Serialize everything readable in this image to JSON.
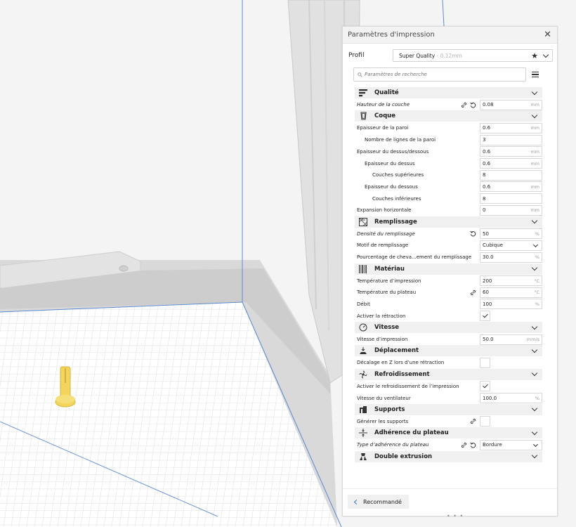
{
  "panel": {
    "title": "Paramètres d'impression",
    "profile_label": "Profil",
    "profile_name": "Super Quality",
    "profile_sub": " - 0.12mm",
    "search_placeholder": "Paramètres de recherche",
    "recommend_label": "Recommandé",
    "handle": "• • •"
  },
  "colors": {
    "accent": "#3e6fb3",
    "model": "#f2d55d",
    "buildplate": "#ffffff",
    "grid": "#d7d7d7",
    "frame": "#dcdcdc"
  },
  "categories": [
    {
      "label": "Qualité",
      "icon": "quality-icon",
      "settings": [
        {
          "label": "Hauteur de la couche",
          "italic": true,
          "indent": 0,
          "type": "number",
          "value": "0.08",
          "unit": "mm",
          "icons": [
            "link",
            "reset"
          ]
        }
      ]
    },
    {
      "label": "Coque",
      "icon": "shell-icon",
      "settings": [
        {
          "label": "Épaisseur de la paroi",
          "indent": 0,
          "type": "number",
          "value": "0.6",
          "unit": "mm"
        },
        {
          "label": "Nombre de lignes de la paroi",
          "indent": 1,
          "type": "number",
          "value": "3",
          "unit": ""
        },
        {
          "label": "Épaisseur du dessus/dessous",
          "indent": 0,
          "type": "number",
          "value": "0.6",
          "unit": "mm"
        },
        {
          "label": "Épaisseur du dessus",
          "indent": 1,
          "type": "number",
          "value": "0.6",
          "unit": "mm"
        },
        {
          "label": "Couches supérieures",
          "indent": 2,
          "type": "number",
          "value": "8",
          "unit": ""
        },
        {
          "label": "Épaisseur du dessous",
          "indent": 1,
          "type": "number",
          "value": "0.6",
          "unit": "mm"
        },
        {
          "label": "Couches inférieures",
          "indent": 2,
          "type": "number",
          "value": "8",
          "unit": ""
        },
        {
          "label": "Expansion horizontale",
          "indent": 0,
          "type": "number",
          "value": "0",
          "unit": "mm"
        }
      ]
    },
    {
      "label": "Remplissage",
      "icon": "infill-icon",
      "settings": [
        {
          "label": "Densité du remplissage",
          "italic": true,
          "indent": 0,
          "type": "number",
          "value": "50",
          "unit": "%",
          "icons": [
            "reset"
          ]
        },
        {
          "label": "Motif de remplissage",
          "indent": 0,
          "type": "select",
          "value": "Cubique"
        },
        {
          "label": "Pourcentage de cheva...ement du remplissage",
          "indent": 0,
          "type": "number",
          "value": "30.0",
          "unit": "%"
        }
      ]
    },
    {
      "label": "Matériau",
      "icon": "material-icon",
      "settings": [
        {
          "label": "Température d’impression",
          "indent": 0,
          "type": "number",
          "value": "200",
          "unit": "°C"
        },
        {
          "label": "Température du plateau",
          "indent": 0,
          "type": "number",
          "value": "60",
          "unit": "°C",
          "icons": [
            "link"
          ]
        },
        {
          "label": "Débit",
          "indent": 0,
          "type": "number",
          "value": "100",
          "unit": "%"
        },
        {
          "label": "Activer la rétraction",
          "indent": 0,
          "type": "checkbox",
          "checked": true
        }
      ]
    },
    {
      "label": "Vitesse",
      "icon": "speed-icon",
      "settings": [
        {
          "label": "Vitesse d’impression",
          "indent": 0,
          "type": "number",
          "value": "50.0",
          "unit": "mm/s"
        }
      ]
    },
    {
      "label": "Déplacement",
      "icon": "travel-icon",
      "settings": [
        {
          "label": "Décalage en Z lors d’une rétraction",
          "indent": 0,
          "type": "checkbox",
          "checked": false
        }
      ]
    },
    {
      "label": "Refroidissement",
      "icon": "cooling-icon",
      "settings": [
        {
          "label": "Activer le refroidissement de l’impression",
          "indent": 0,
          "type": "checkbox",
          "checked": true
        },
        {
          "label": "Vitesse du ventilateur",
          "indent": 0,
          "type": "number",
          "value": "100.0",
          "unit": "%"
        }
      ]
    },
    {
      "label": "Supports",
      "icon": "support-icon",
      "settings": [
        {
          "label": "Générer les supports",
          "indent": 0,
          "type": "checkbox",
          "checked": false,
          "icons": [
            "link"
          ]
        }
      ]
    },
    {
      "label": "Adhérence du plateau",
      "icon": "adhesion-icon",
      "settings": [
        {
          "label": "Type d’adhérence du plateau",
          "italic": true,
          "indent": 0,
          "type": "select",
          "value": "Bordure",
          "icons": [
            "link",
            "reset"
          ]
        }
      ]
    },
    {
      "label": "Double extrusion",
      "icon": "dual-extrusion-icon",
      "settings": []
    }
  ]
}
